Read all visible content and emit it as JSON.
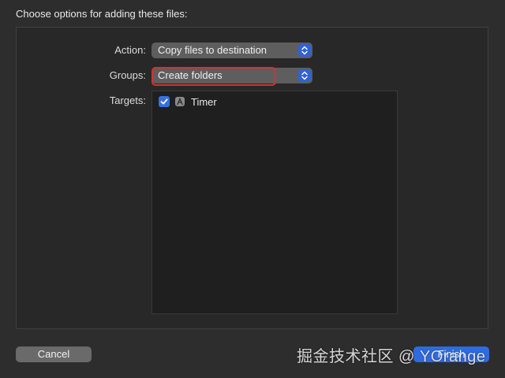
{
  "dialog": {
    "title": "Choose options for adding these files:"
  },
  "form": {
    "action_label": "Action:",
    "action_value": "Copy files to destination",
    "groups_label": "Groups:",
    "groups_value": "Create folders",
    "targets_label": "Targets:",
    "targets": [
      {
        "name": "Timer",
        "checked": true,
        "icon": "app-icon"
      }
    ]
  },
  "buttons": {
    "cancel": "Cancel",
    "finish": "Finish"
  },
  "watermark": {
    "text": "掘金技术社区 @ YOrange"
  },
  "colors": {
    "accent": "#2f6be0",
    "highlight_outline": "#d0332f"
  }
}
